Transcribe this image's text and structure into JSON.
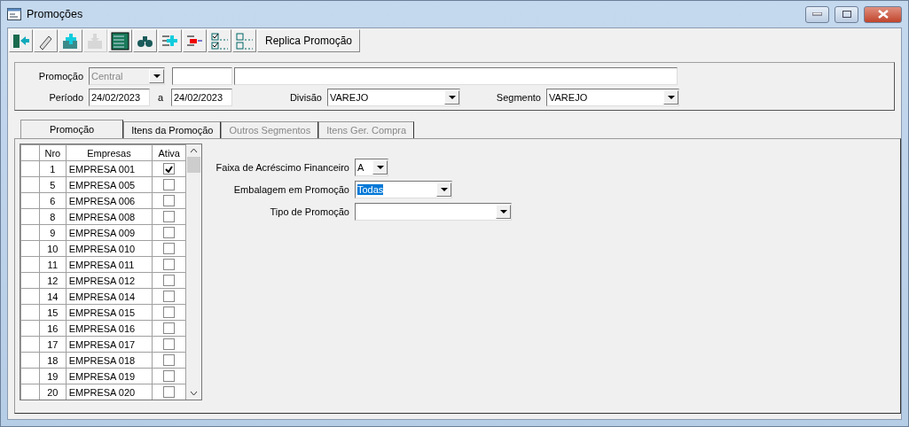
{
  "window": {
    "title": "Promoções"
  },
  "toolbar": {
    "buttons": [
      {
        "disabled": false
      },
      {
        "disabled": false
      },
      {
        "disabled": false
      },
      {
        "disabled": true
      },
      {
        "disabled": false
      },
      {
        "disabled": false
      },
      {
        "disabled": false
      },
      {
        "disabled": false
      },
      {
        "disabled": false
      },
      {
        "disabled": false
      }
    ],
    "text_button": "Replica Promoção"
  },
  "header": {
    "promocao_label": "Promoção",
    "promocao_combo": {
      "value": "Central",
      "disabled": true
    },
    "periodo_label": "Período",
    "date_from": "24/02/2023",
    "date_sep": "a",
    "date_to": "24/02/2023",
    "divisao_label": "Divisão",
    "divisao": "VAREJO",
    "segmento_label": "Segmento",
    "segmento": "VAREJO"
  },
  "tabs": [
    {
      "label": "Promoção",
      "selected": true,
      "disabled": false
    },
    {
      "label": "Itens da Promoção",
      "selected": false,
      "disabled": false
    },
    {
      "label": "Outros Segmentos",
      "selected": false,
      "disabled": true
    },
    {
      "label": "Itens Ger. Compra",
      "selected": false,
      "disabled": true
    }
  ],
  "table": {
    "columns": [
      "Nro",
      "Empresas",
      "Ativa"
    ],
    "rows": [
      {
        "nro": "1",
        "empresa": "EMPRESA 001",
        "checked": true
      },
      {
        "nro": "5",
        "empresa": "EMPRESA 005",
        "checked": false
      },
      {
        "nro": "6",
        "empresa": "EMPRESA 006",
        "checked": false
      },
      {
        "nro": "8",
        "empresa": "EMPRESA 008",
        "checked": false
      },
      {
        "nro": "9",
        "empresa": "EMPRESA 009",
        "checked": false
      },
      {
        "nro": "10",
        "empresa": "EMPRESA 010",
        "checked": false
      },
      {
        "nro": "11",
        "empresa": "EMPRESA 011",
        "checked": false
      },
      {
        "nro": "12",
        "empresa": "EMPRESA 012",
        "checked": false
      },
      {
        "nro": "14",
        "empresa": "EMPRESA 014",
        "checked": false
      },
      {
        "nro": "15",
        "empresa": "EMPRESA 015",
        "checked": false
      },
      {
        "nro": "16",
        "empresa": "EMPRESA 016",
        "checked": false
      },
      {
        "nro": "17",
        "empresa": "EMPRESA 017",
        "checked": false
      },
      {
        "nro": "18",
        "empresa": "EMPRESA 018",
        "checked": false
      },
      {
        "nro": "19",
        "empresa": "EMPRESA 019",
        "checked": false
      },
      {
        "nro": "20",
        "empresa": "EMPRESA 020",
        "checked": false
      }
    ]
  },
  "form": [
    {
      "label": "Faixa de Acréscimo Financeiro",
      "value": "A",
      "highlighted": false
    },
    {
      "label": "Embalagem em Promoção",
      "value": "Todas",
      "highlighted": true
    },
    {
      "label": "Tipo de Promoção"
    }
  ]
}
